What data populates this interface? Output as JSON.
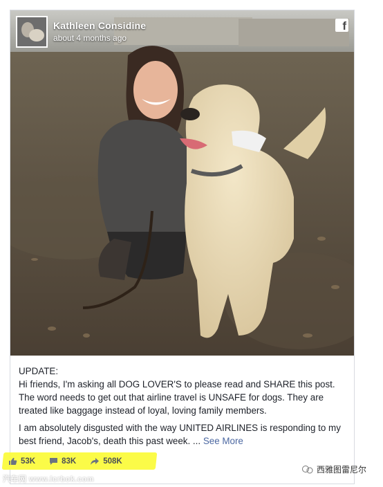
{
  "post": {
    "author": "Kathleen Considine",
    "timestamp": "about 4 months ago",
    "brand_glyph": "f",
    "paragraphs": [
      "UPDATE:\nHi friends, I'm asking all DOG LOVER'S to please read and SHARE this post. The word needs to get out that airline travel is UNSAFE for dogs. They are treated like baggage instead of loyal, loving family members.",
      "I am absolutely disgusted with the way UNITED AIRLINES is responding to my best friend, Jacob's, death this past week. ..."
    ],
    "see_more": "See More"
  },
  "stats": {
    "likes": "53K",
    "comments": "83K",
    "shares": "508K"
  },
  "watermarks": {
    "left": "汽车网 www.lcrbok.com",
    "right": "西雅图雷尼尔"
  },
  "colors": {
    "link": "#4b67a1",
    "highlight": "#fbfb3e",
    "text": "#1d2129",
    "icon": "#6b7380"
  }
}
